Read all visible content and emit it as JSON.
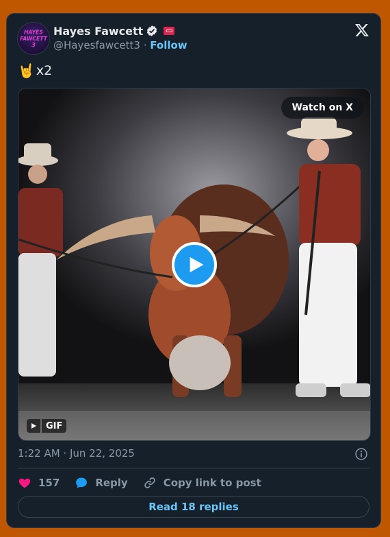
{
  "author": {
    "name": "Hayes Fawcett",
    "handle": "@Hayesfawcett3",
    "separator": "·",
    "follow_label": "Follow",
    "avatar_text_line1": "HAYES",
    "avatar_text_line2": "FAWCETT",
    "avatar_text_line3": "3"
  },
  "icons": {
    "verified": "verified-badge-icon",
    "affiliate": "affiliate-badge-icon",
    "brand": "x-logo-icon",
    "info": "info-icon",
    "like": "heart-icon",
    "reply": "speech-bubble-icon",
    "copy": "link-icon",
    "play": "play-icon"
  },
  "tweet": {
    "emoji": "🤘",
    "text": "x2"
  },
  "media": {
    "watch_label": "Watch on X",
    "badge_label": "GIF"
  },
  "meta": {
    "timestamp": "1:22 AM · Jun 22, 2025"
  },
  "actions": {
    "like_count": "157",
    "reply_label": "Reply",
    "copy_label": "Copy link to post"
  },
  "footer": {
    "read_replies_label": "Read 18 replies"
  },
  "colors": {
    "page_background": "#bf5700",
    "card_background": "#15202b",
    "accent": "#1d9bf0",
    "link": "#6cc5f7",
    "like": "#f91880"
  }
}
